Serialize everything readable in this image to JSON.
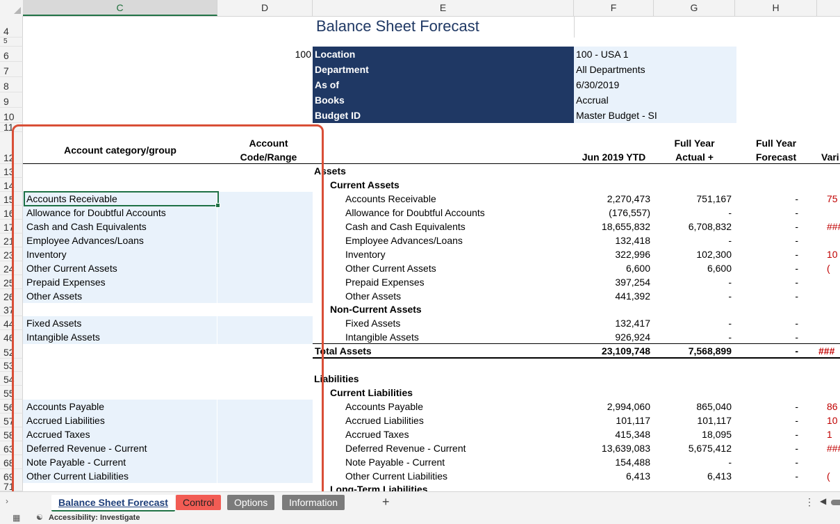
{
  "columns": [
    "C",
    "D",
    "E",
    "F",
    "G",
    "H"
  ],
  "title": "Balance Sheet Forecast",
  "location_code": "100",
  "params": [
    {
      "label": "Location",
      "value": "100 - USA 1"
    },
    {
      "label": "Department",
      "value": "All Departments"
    },
    {
      "label": "As of",
      "value": "6/30/2019"
    },
    {
      "label": "Books",
      "value": "Accrual"
    },
    {
      "label": "Budget ID",
      "value": "Master Budget - SI"
    }
  ],
  "headers": {
    "account_group": "Account category/group",
    "account_code": "Account Code/Range",
    "f": "Jun 2019 YTD",
    "g": "Full Year Actual + Budget",
    "h": "Full Year Forecast",
    "i": "Vari"
  },
  "sections": {
    "assets": "Assets",
    "current_assets": "Current Assets",
    "noncurrent_assets": "Non-Current Assets",
    "total_assets": "Total Assets",
    "liabilities": "Liabilities",
    "current_liabilities": "Current Liabilities",
    "longterm_liabilities": "Long-Term Liabilities"
  },
  "rows": [
    {
      "rn": "15",
      "left": "Accounts Receivable",
      "e": "Accounts Receivable",
      "f": "2,270,473",
      "g": "751,167",
      "h": "-",
      "i": "75"
    },
    {
      "rn": "16",
      "left": "Allowance for Doubtful Accounts",
      "e": "Allowance for Doubtful Accounts",
      "f": "(176,557)",
      "g": "-",
      "h": "-",
      "i": ""
    },
    {
      "rn": "17",
      "left": "Cash and Cash Equivalents",
      "e": "Cash and Cash Equivalents",
      "f": "18,655,832",
      "g": "6,708,832",
      "h": "-",
      "i": "###"
    },
    {
      "rn": "21",
      "left": "Employee Advances/Loans",
      "e": "Employee Advances/Loans",
      "f": "132,418",
      "g": "-",
      "h": "-",
      "i": ""
    },
    {
      "rn": "23",
      "left": "Inventory",
      "e": "Inventory",
      "f": "322,996",
      "g": "102,300",
      "h": "-",
      "i": "10"
    },
    {
      "rn": "24",
      "left": "Other Current Assets",
      "e": "Other Current Assets",
      "f": "6,600",
      "g": "6,600",
      "h": "-",
      "i": "("
    },
    {
      "rn": "25",
      "left": "Prepaid Expenses",
      "e": "Prepaid Expenses",
      "f": "397,254",
      "g": "-",
      "h": "-",
      "i": ""
    },
    {
      "rn": "26",
      "left": "Other Assets",
      "e": "Other Assets",
      "f": "441,392",
      "g": "-",
      "h": "-",
      "i": ""
    },
    {
      "rn": "44",
      "left": "Fixed Assets",
      "e": "Fixed Assets",
      "f": "132,417",
      "g": "-",
      "h": "-",
      "i": ""
    },
    {
      "rn": "46",
      "left": "Intangible Assets",
      "e": "Intangible Assets",
      "f": "926,924",
      "g": "-",
      "h": "-",
      "i": ""
    },
    {
      "rn": "56",
      "left": "Accounts Payable",
      "e": "Accounts Payable",
      "f": "2,994,060",
      "g": "865,040",
      "h": "-",
      "i": "86"
    },
    {
      "rn": "57",
      "left": "Accrued Liabilities",
      "e": "Accrued Liabilities",
      "f": "101,117",
      "g": "101,117",
      "h": "-",
      "i": "10"
    },
    {
      "rn": "58",
      "left": "Accrued Taxes",
      "e": "Accrued Taxes",
      "f": "415,348",
      "g": "18,095",
      "h": "-",
      "i": "1"
    },
    {
      "rn": "63",
      "left": "Deferred Revenue - Current",
      "e": "Deferred Revenue - Current",
      "f": "13,639,083",
      "g": "5,675,412",
      "h": "-",
      "i": "###"
    },
    {
      "rn": "68",
      "left": "Note Payable - Current",
      "e": "Note Payable - Current",
      "f": "154,488",
      "g": "-",
      "h": "-",
      "i": ""
    },
    {
      "rn": "69",
      "left": "Other Current Liabilities",
      "e": "Other Current Liabilities",
      "f": "6,413",
      "g": "6,413",
      "h": "-",
      "i": "("
    }
  ],
  "total_assets": {
    "f": "23,109,748",
    "g": "7,568,899",
    "h": "-",
    "i": "###"
  },
  "row_numbers": {
    "r4": "4",
    "r5": "5",
    "r6": "6",
    "r7": "7",
    "r8": "8",
    "r9": "9",
    "r10": "10",
    "r11": "11",
    "r12": "12",
    "r13": "13",
    "r14": "14",
    "r37": "37",
    "r52": "52",
    "r53": "53",
    "r54": "54",
    "r55": "55",
    "r71": "71"
  },
  "tabs": [
    "Balance Sheet Forecast",
    "Control",
    "Options",
    "Information"
  ],
  "add_tab": "+",
  "status": {
    "accessibility": "Accessibility: Investigate"
  }
}
